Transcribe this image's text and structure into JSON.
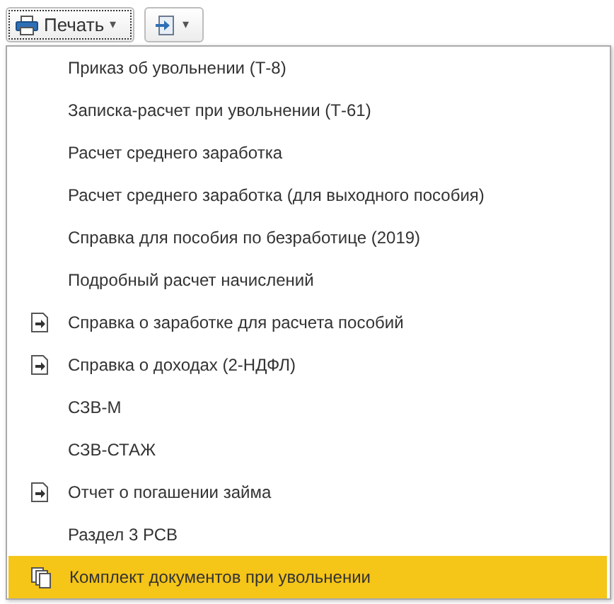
{
  "toolbar": {
    "print_button": {
      "label": "Печать",
      "caret": "▾"
    },
    "extra_button": {
      "caret": "▾"
    }
  },
  "menu": {
    "items": [
      {
        "label": "Приказ об увольнении (Т-8)",
        "kind": "plain",
        "selected": false
      },
      {
        "label": "Записка-расчет при увольнении (Т-61)",
        "kind": "plain",
        "selected": false
      },
      {
        "label": "Расчет среднего заработка",
        "kind": "plain",
        "selected": false
      },
      {
        "label": "Расчет среднего заработка (для выходного пособия)",
        "kind": "plain",
        "selected": false
      },
      {
        "label": "Справка для пособия по безработице (2019)",
        "kind": "plain",
        "selected": false
      },
      {
        "label": "Подробный расчет начислений",
        "kind": "plain",
        "selected": false
      },
      {
        "label": "Справка о заработке для расчета пособий",
        "kind": "document",
        "selected": false
      },
      {
        "label": "Справка о доходах (2-НДФЛ)",
        "kind": "document",
        "selected": false
      },
      {
        "label": "СЗВ-М",
        "kind": "plain",
        "selected": false
      },
      {
        "label": "СЗВ-СТАЖ",
        "kind": "plain",
        "selected": false
      },
      {
        "label": "Отчет о погашении займа",
        "kind": "document",
        "selected": false
      },
      {
        "label": "Раздел 3 РСВ",
        "kind": "plain",
        "selected": false
      },
      {
        "label": "Комплект документов при увольнении",
        "kind": "set",
        "selected": true
      }
    ]
  }
}
